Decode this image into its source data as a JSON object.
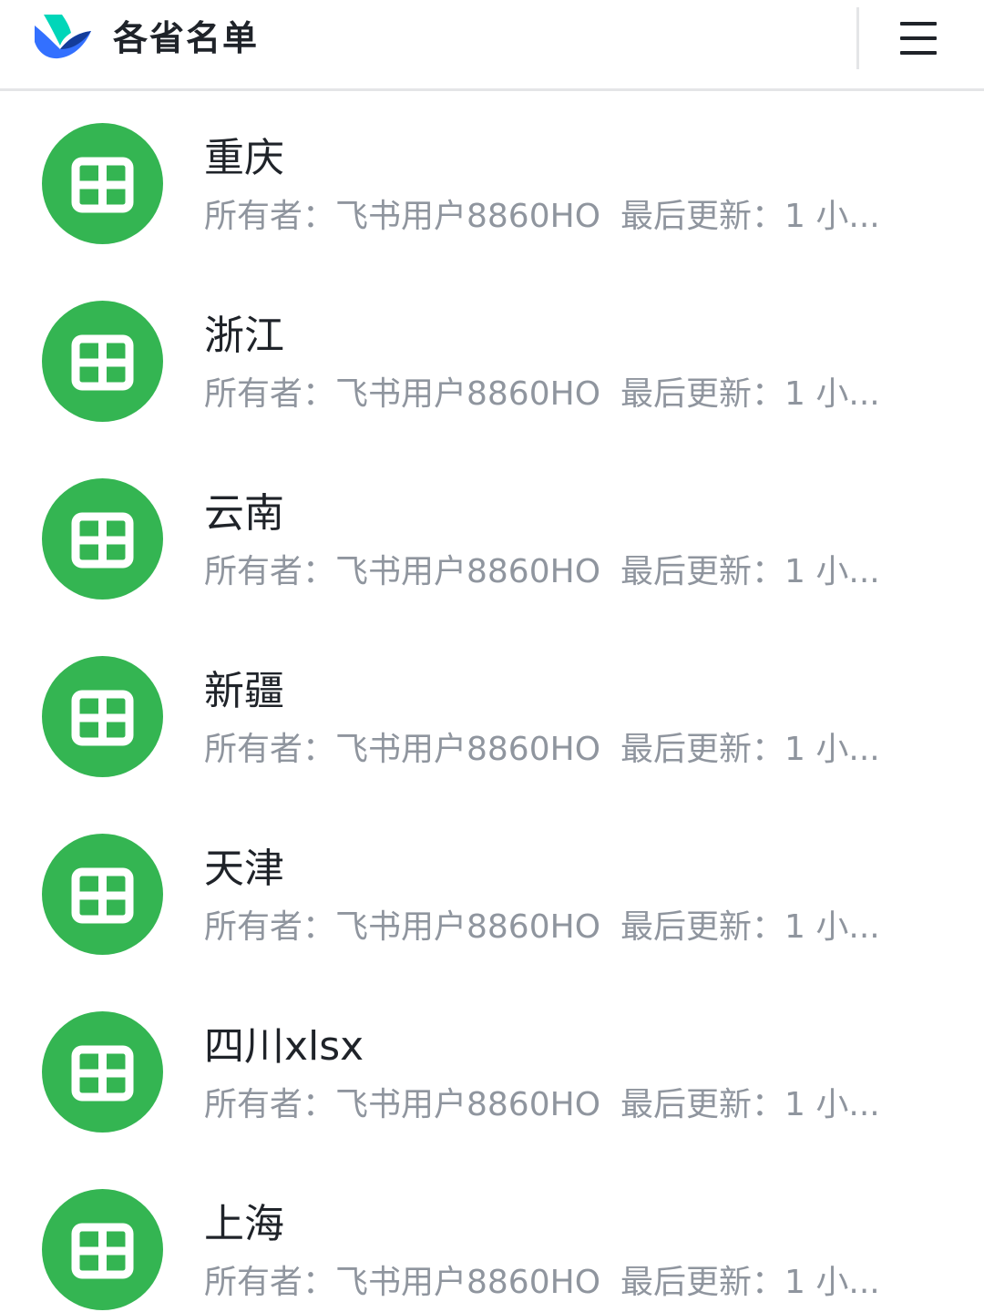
{
  "header": {
    "title": "各省名单",
    "logo_icon": "feishu-logo",
    "menu_icon": "hamburger-menu-icon"
  },
  "colors": {
    "sheet_icon_bg": "#34b552",
    "title_text": "#1f2329",
    "meta_text": "#8f959e",
    "divider": "#e4e5e7"
  },
  "files": [
    {
      "name": "重庆",
      "owner": "所有者：飞书用户8860HO",
      "updated": "最后更新：1 小..."
    },
    {
      "name": "浙江",
      "owner": "所有者：飞书用户8860HO",
      "updated": "最后更新：1 小..."
    },
    {
      "name": "云南",
      "owner": "所有者：飞书用户8860HO",
      "updated": "最后更新：1 小..."
    },
    {
      "name": "新疆",
      "owner": "所有者：飞书用户8860HO",
      "updated": "最后更新：1 小..."
    },
    {
      "name": "天津",
      "owner": "所有者：飞书用户8860HO",
      "updated": "最后更新：1 小..."
    },
    {
      "name": "四川xlsx",
      "owner": "所有者：飞书用户8860HO",
      "updated": "最后更新：1 小..."
    },
    {
      "name": "上海",
      "owner": "所有者：飞书用户8860HO",
      "updated": "最后更新：1 小..."
    }
  ]
}
